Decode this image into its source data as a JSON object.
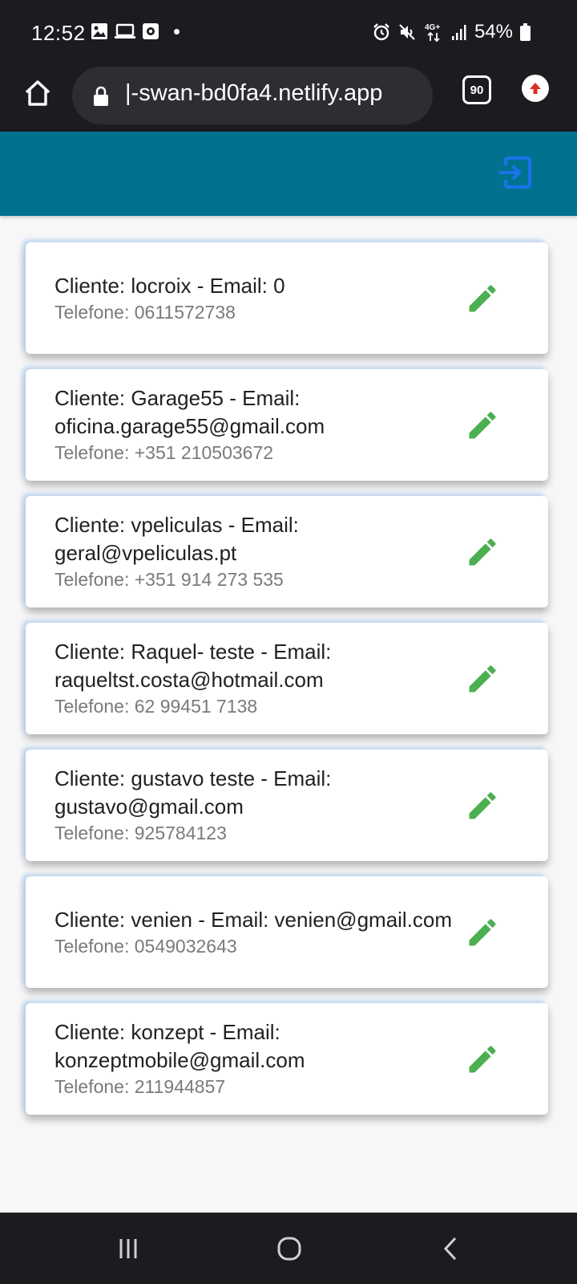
{
  "status_bar": {
    "time": "12:52",
    "network": "4G+",
    "battery": "54%"
  },
  "browser": {
    "url": "|-swan-bd0fa4.netlify.app",
    "tab_count": "90"
  },
  "colors": {
    "app_bar": "#00728f",
    "logout_icon": "#1a73e8",
    "edit_icon": "#4caf50"
  },
  "clients": [
    {
      "title": "Cliente: locroix -  Email: 0",
      "phone": "Telefone: 0611572738"
    },
    {
      "title": "Cliente: Garage55 -  Email: oficina.garage55@gmail.com",
      "phone": "Telefone: +351 210503672"
    },
    {
      "title": "Cliente: vpeliculas -  Email: geral@vpeliculas.pt",
      "phone": "Telefone: +351 914 273 535"
    },
    {
      "title": "Cliente: Raquel- teste -  Email: raqueltst.costa@hotmail.com",
      "phone": "Telefone: 62 99451 7138"
    },
    {
      "title": "Cliente: gustavo teste -  Email: gustavo@gmail.com",
      "phone": "Telefone: 925784123"
    },
    {
      "title": "Cliente: venien -  Email: venien@gmail.com",
      "phone": "Telefone: 0549032643"
    },
    {
      "title": "Cliente: konzept -  Email: konzeptmobile@gmail.com",
      "phone": "Telefone: 211944857"
    }
  ]
}
